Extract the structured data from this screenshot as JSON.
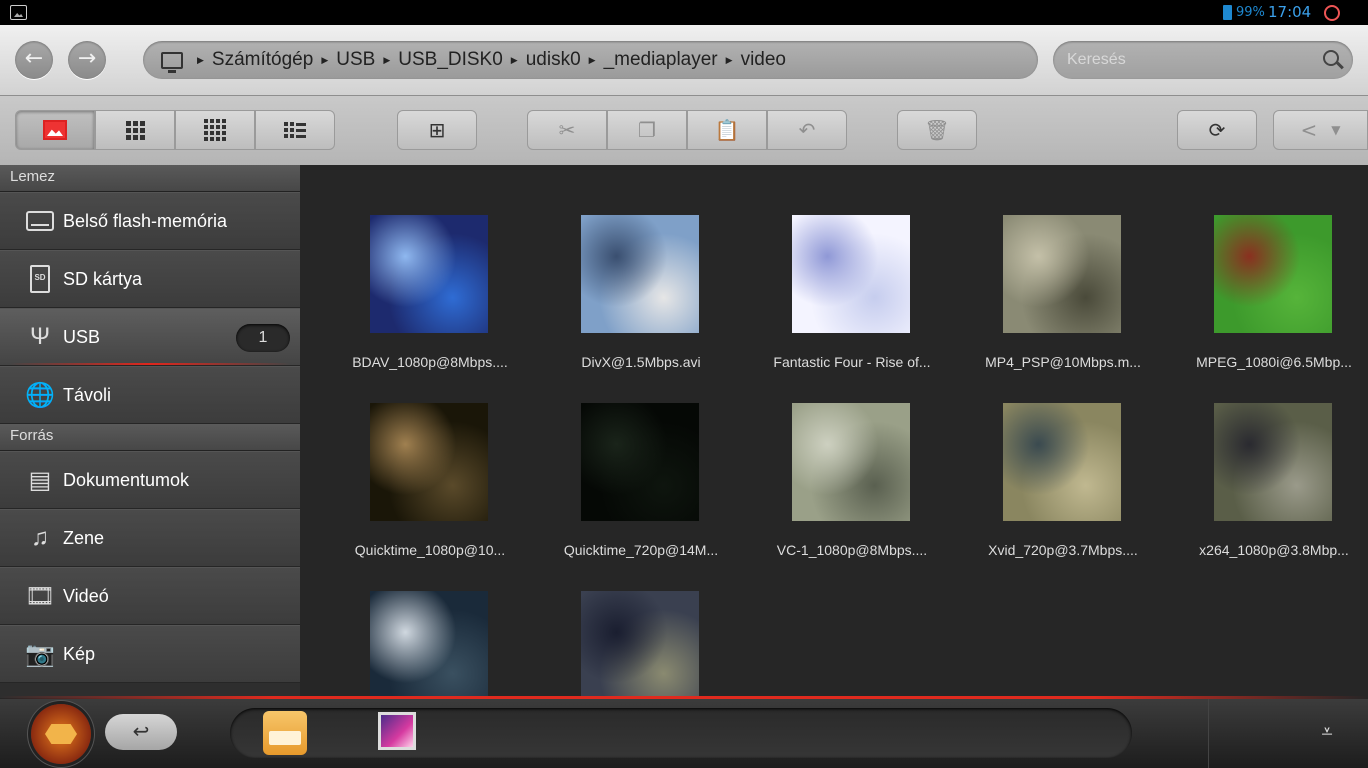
{
  "status_bar": {
    "battery_percent": "99%",
    "time": "17:04"
  },
  "address_bar": {
    "breadcrumbs": [
      "Számítógép",
      "USB",
      "USB_DISK0",
      "udisk0",
      "_mediaplayer",
      "video"
    ],
    "search_placeholder": "Keresés"
  },
  "sidebar": {
    "sections": [
      {
        "title": "Lemez",
        "items": [
          {
            "label": "Belső flash-memória",
            "icon": "drive-icon"
          },
          {
            "label": "SD kártya",
            "icon": "sd-card-icon"
          },
          {
            "label": "USB",
            "icon": "usb-icon",
            "badge": "1",
            "selected": true
          },
          {
            "label": "Távoli",
            "icon": "network-icon"
          }
        ]
      },
      {
        "title": "Forrás",
        "items": [
          {
            "label": "Dokumentumok",
            "icon": "document-icon"
          },
          {
            "label": "Zene",
            "icon": "music-icon"
          },
          {
            "label": "Videó",
            "icon": "film-icon"
          },
          {
            "label": "Kép",
            "icon": "camera-icon"
          }
        ]
      }
    ]
  },
  "files": [
    {
      "name": "BDAV_1080p@8Mbps....",
      "colors": [
        "#1d2a6e",
        "#2f6cd4",
        "#8fb8f0"
      ]
    },
    {
      "name": "DivX@1.5Mbps.avi",
      "colors": [
        "#7fa0c8",
        "#e6e6e6",
        "#3a4f70"
      ]
    },
    {
      "name": "Fantastic Four - Rise of...",
      "colors": [
        "#f4f4ff",
        "#c6cdee",
        "#8f98d6"
      ]
    },
    {
      "name": "MP4_PSP@10Mbps.m...",
      "colors": [
        "#8a8a74",
        "#4a4a3a",
        "#c4c0a8"
      ]
    },
    {
      "name": "MPEG_1080i@6.5Mbp...",
      "colors": [
        "#3d9a2c",
        "#56b43a",
        "#8a3020"
      ]
    },
    {
      "name": "Quicktime_1080p@10...",
      "colors": [
        "#1a1608",
        "#5a4a2a",
        "#a08050"
      ]
    },
    {
      "name": "Quicktime_720p@14M...",
      "colors": [
        "#050805",
        "#0e150e",
        "#1a241a"
      ]
    },
    {
      "name": "VC-1_1080p@8Mbps....",
      "colors": [
        "#9aa088",
        "#5a6050",
        "#cdd0c0"
      ]
    },
    {
      "name": "Xvid_720p@3.7Mbps....",
      "colors": [
        "#8a8660",
        "#c0b890",
        "#3a4a50"
      ]
    },
    {
      "name": "x264_1080p@3.8Mbp...",
      "colors": [
        "#5a5e48",
        "#9a9a8a",
        "#2a2a30"
      ]
    },
    {
      "name": "",
      "colors": [
        "#1a2a3a",
        "#3a5060",
        "#d0d8e0"
      ]
    },
    {
      "name": "",
      "colors": [
        "#3a4050",
        "#8a8a70",
        "#1a1e30"
      ]
    }
  ],
  "bottom_bar": {
    "apps": [
      "file-manager-icon",
      "gallery-icon"
    ]
  }
}
